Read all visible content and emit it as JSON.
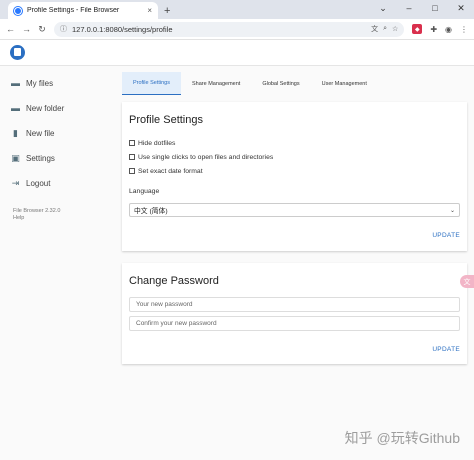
{
  "browser": {
    "tab_title": "Profile Settings - File Browser",
    "tab_close": "×",
    "new_tab": "+",
    "url": "127.0.0.1:8080/settings/profile",
    "window_controls": [
      "⌄",
      "–",
      "□",
      "✕"
    ]
  },
  "sidebar": {
    "items": [
      {
        "label": "My files",
        "icon": "folder-icon"
      },
      {
        "label": "New folder",
        "icon": "create-folder-icon"
      },
      {
        "label": "New file",
        "icon": "note-add-icon"
      },
      {
        "label": "Settings",
        "icon": "settings-icon"
      },
      {
        "label": "Logout",
        "icon": "logout-icon"
      }
    ],
    "version": "File Browser 2.32.0",
    "help": "Help"
  },
  "settings_tabs": [
    "Profile Settings",
    "Share Management",
    "Global Settings",
    "User Management"
  ],
  "profile": {
    "title": "Profile Settings",
    "options": [
      "Hide dotfiles",
      "Use single clicks to open files and directories",
      "Set exact date format"
    ],
    "language_label": "Language",
    "language_value": "中文 (简体)",
    "update": "UPDATE"
  },
  "password": {
    "title": "Change Password",
    "new_placeholder": "Your new password",
    "confirm_placeholder": "Confirm your new password",
    "update": "UPDATE"
  },
  "watermark": "知乎 @玩转Github",
  "colors": {
    "accent": "#2b6fc2",
    "active_tab_bg": "#e3eefa"
  }
}
